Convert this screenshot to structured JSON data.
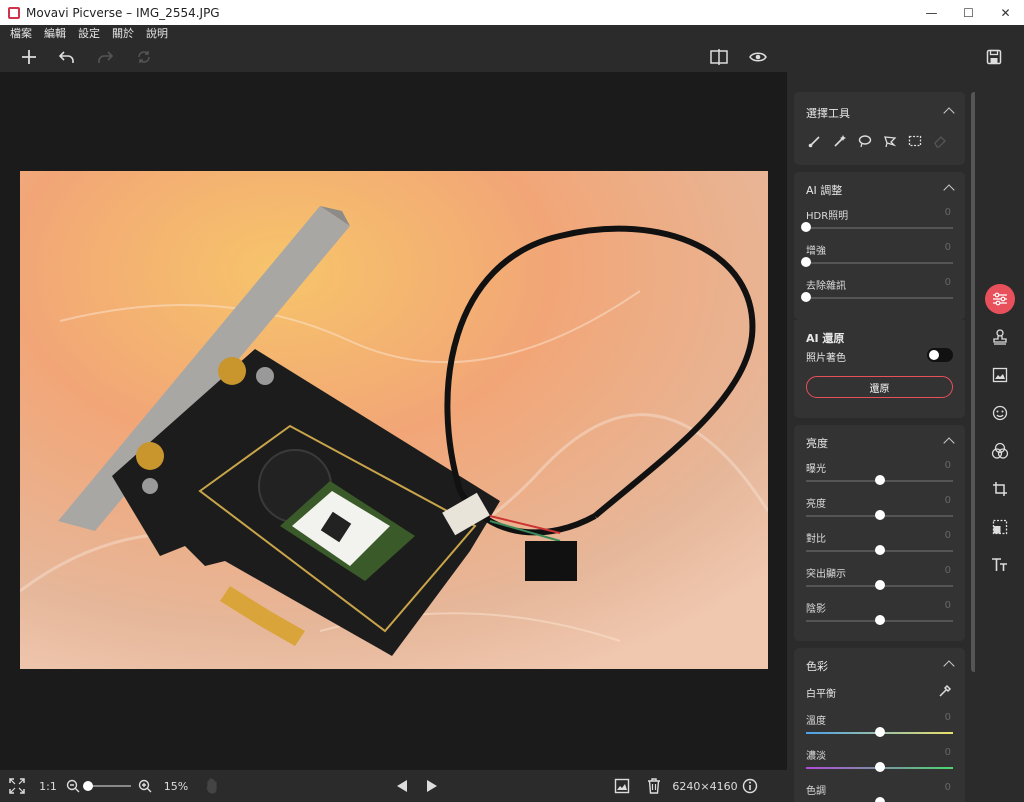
{
  "window": {
    "title": "Movavi Picverse – IMG_2554.JPG",
    "min": "—",
    "max": "☐",
    "close": "✕"
  },
  "menu": [
    "檔案",
    "編輯",
    "設定",
    "關於",
    "說明"
  ],
  "panels": {
    "select_tool": {
      "title": "選擇工具"
    },
    "ai_adjust": {
      "title": "AI 調整",
      "sliders": [
        {
          "label": "HDR照明",
          "value": "0",
          "level": 0
        },
        {
          "label": "增強",
          "value": "0",
          "level": 0
        },
        {
          "label": "去除雜訊",
          "value": "0",
          "level": 0
        }
      ]
    },
    "ai_restore": {
      "title": "AI 還原",
      "toggle_label": "照片著色",
      "button": "還原"
    },
    "brightness": {
      "title": "亮度",
      "sliders": [
        {
          "label": "曝光",
          "value": "0",
          "level": 0.5
        },
        {
          "label": "亮度",
          "value": "0",
          "level": 0.5
        },
        {
          "label": "對比",
          "value": "0",
          "level": 0.5
        },
        {
          "label": "突出顯示",
          "value": "0",
          "level": 0.5
        },
        {
          "label": "陰影",
          "value": "0",
          "level": 0.5
        }
      ]
    },
    "color": {
      "title": "色彩",
      "white_balance": "白平衡",
      "sliders": [
        {
          "label": "溫度",
          "value": "0",
          "level": 0.5
        },
        {
          "label": "濃淡",
          "value": "0",
          "level": 0.5
        },
        {
          "label": "色調",
          "value": "0",
          "level": 0.5
        }
      ]
    }
  },
  "bottom": {
    "ratio": "1:1",
    "zoom": "15%",
    "dimensions": "6240×4160"
  },
  "colors": {
    "accent": "#e8505b",
    "panel": "#333333",
    "background": "#1b1b1b"
  }
}
